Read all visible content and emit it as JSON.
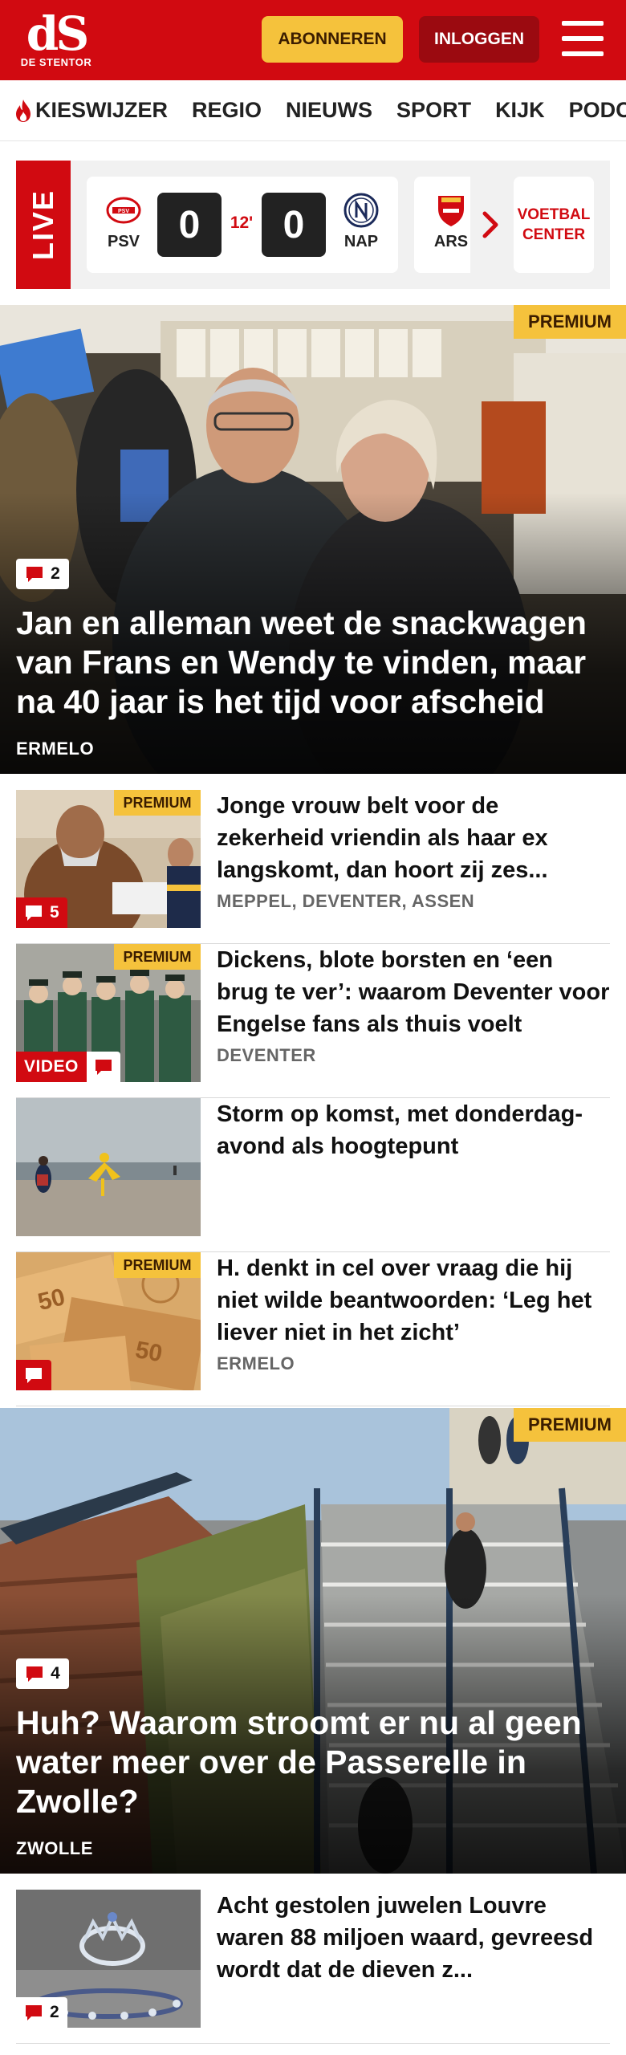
{
  "header": {
    "logo_mark": "dS",
    "logo_sub": "DE STENTOR",
    "subscribe_label": "ABONNEREN",
    "login_label": "INLOGGEN",
    "menu_icon": "hamburger-menu-icon",
    "brand_color": "#d10a11",
    "accent_color": "#f5c23c"
  },
  "nav": {
    "items": [
      {
        "label": "KIESWIJZER",
        "icon": "flame-icon"
      },
      {
        "label": "REGIO"
      },
      {
        "label": "NIEUWS"
      },
      {
        "label": "SPORT"
      },
      {
        "label": "KIJK"
      },
      {
        "label": "PODCASTS"
      }
    ]
  },
  "live": {
    "tag": "LIVE",
    "match": {
      "home_team": "PSV",
      "home_score": "0",
      "minute": "12'",
      "away_score": "0",
      "away_team": "NAP"
    },
    "next_match_team": "ARS",
    "football_center_line1": "VOETBAL",
    "football_center_line2": "CENTER"
  },
  "articles": {
    "hero1": {
      "badge": "PREMIUM",
      "comments": "2",
      "title": "Jan en alleman weet de snackwagen van Frans en Wendy te vinden, maar na 40 jaar is het tijd voor afscheid",
      "location": "ERMELO"
    },
    "item1": {
      "badge": "PREMIUM",
      "comments": "5",
      "title": "Jonge vrouw belt voor de zekerheid vriendin als haar ex langskomt, dan hoort zij zes...",
      "location": "MEPPEL, DEVENTER, ASSEN"
    },
    "item2": {
      "badge": "PREMIUM",
      "video_label": "VIDEO",
      "title": "Dickens, blote borsten en ‘een brug te ver’: waarom Deventer voor Engelse fans als thuis voelt",
      "location": "DEVENTER"
    },
    "item3": {
      "title": "Storm op komst, met donderdag-avond als hoogtepunt"
    },
    "item4": {
      "badge": "PREMIUM",
      "title": "H. denkt in cel over vraag die hij niet wilde beantwoorden: ‘Leg het liever niet in het zicht’",
      "location": "ERMELO"
    },
    "hero2": {
      "badge": "PREMIUM",
      "comments": "4",
      "title": "Huh? Waarom stroomt er nu al geen water meer over de Passerelle in Zwolle?",
      "location": "ZWOLLE"
    },
    "item5": {
      "comments": "2",
      "title": "Acht gestolen juwelen Louvre waren 88 miljoen waard, gevreesd wordt dat de dieven z..."
    }
  }
}
